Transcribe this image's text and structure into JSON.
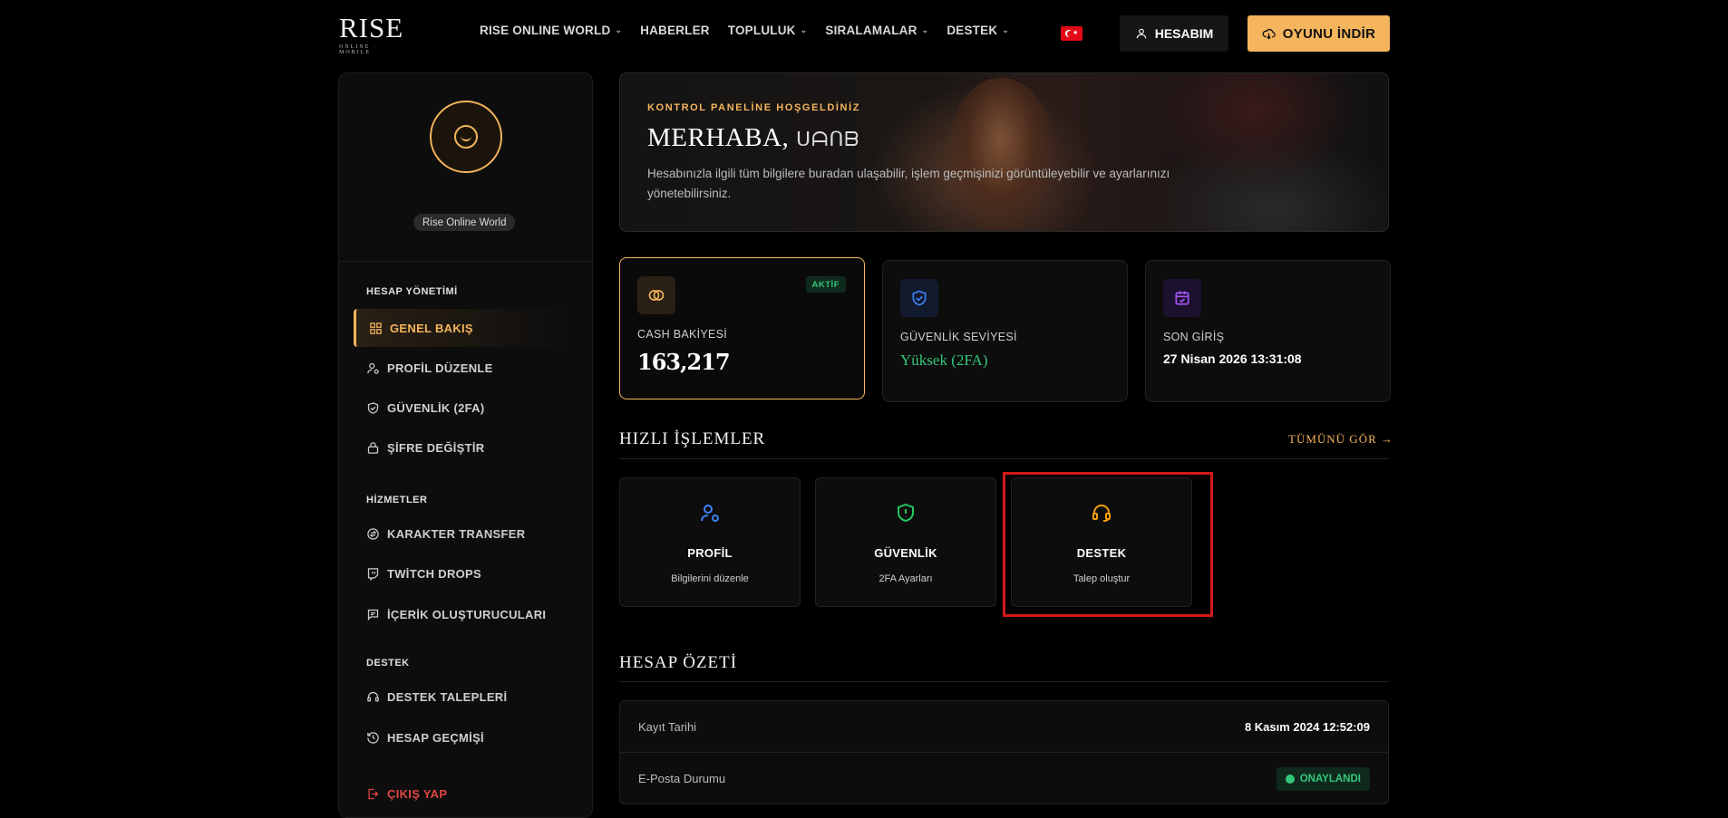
{
  "header": {
    "logo_main": "RISE",
    "logo_sub": "ONLINE · MOBILE",
    "nav": [
      {
        "label": "RISE ONLINE WORLD",
        "dropdown": true
      },
      {
        "label": "HABERLER",
        "dropdown": false
      },
      {
        "label": "TOPLULUK",
        "dropdown": true
      },
      {
        "label": "SIRALAMALAR",
        "dropdown": true
      },
      {
        "label": "DESTEK",
        "dropdown": true
      }
    ],
    "account_label": "HESABIM",
    "download_label": "OYUNU İNDİR"
  },
  "sidebar": {
    "server_badge": "Rise Online World",
    "sections": [
      {
        "title": "HESAP YÖNETİMİ"
      },
      {
        "title": "HİZMETLER"
      },
      {
        "title": "DESTEK"
      }
    ],
    "items": [
      {
        "label": "GENEL BAKIŞ",
        "icon": "dashboard-icon",
        "active": true
      },
      {
        "label": "PROFİL DÜZENLE",
        "icon": "user-gear-icon"
      },
      {
        "label": "GÜVENLİK (2FA)",
        "icon": "shield-check-icon"
      },
      {
        "label": "ŞİFRE DEĞİŞTİR",
        "icon": "lock-icon"
      },
      {
        "label": "KARAKTER TRANSFER",
        "icon": "transfer-icon"
      },
      {
        "label": "TWİTCH DROPS",
        "icon": "twitch-icon"
      },
      {
        "label": "İÇERİK OLUŞTURUCULARI",
        "icon": "message-icon"
      },
      {
        "label": "DESTEK TALEPLERİ",
        "icon": "headset-icon"
      },
      {
        "label": "HESAP GEÇMİŞİ",
        "icon": "history-icon"
      },
      {
        "label": "ÇIKIŞ YAP",
        "icon": "logout-icon"
      }
    ]
  },
  "hero": {
    "kicker": "KONTROL PANELİNE HOŞGELDİNİZ",
    "greeting": "MERHABA,",
    "username": "ᑌᗩᑎᗷ",
    "description": "Hesabınızla ilgili tüm bilgilere buradan ulaşabilir, işlem geçmişinizi görüntüleyebilir ve ayarlarınızı yönetebilirsiniz."
  },
  "stats": {
    "cash": {
      "label": "CASH BAKİYESİ",
      "value": "163,217",
      "badge": "AKTİF"
    },
    "security": {
      "label": "GÜVENLİK SEVİYESİ",
      "value": "Yüksek (2FA)"
    },
    "last_login": {
      "label": "SON GİRİŞ",
      "value": "27 Nisan 2026 13:31:08"
    }
  },
  "quick_actions": {
    "title": "HIZLI İŞLEMLER",
    "see_all": "TÜMÜNÜ GÖR →",
    "items": [
      {
        "title": "PROFİL",
        "subtitle": "Bilgilerini düzenle",
        "icon": "user-gear-icon",
        "color": "#3b82f6"
      },
      {
        "title": "GÜVENLİK",
        "subtitle": "2FA Ayarları",
        "icon": "shield-alert-icon",
        "color": "#22c55e"
      },
      {
        "title": "DESTEK",
        "subtitle": "Talep oluştur",
        "icon": "headset-icon",
        "color": "#f59e0b"
      }
    ]
  },
  "summary": {
    "title": "HESAP ÖZETİ",
    "rows": [
      {
        "key": "Kayıt Tarihi",
        "value": "8 Kasım 2024 12:52:09"
      },
      {
        "key": "E-Posta Durumu",
        "value": "ONAYLANDI"
      }
    ]
  },
  "colors": {
    "accent": "#f5b55d",
    "success": "#34c77b",
    "danger": "#e04646",
    "highlight": "#d11a1a"
  }
}
